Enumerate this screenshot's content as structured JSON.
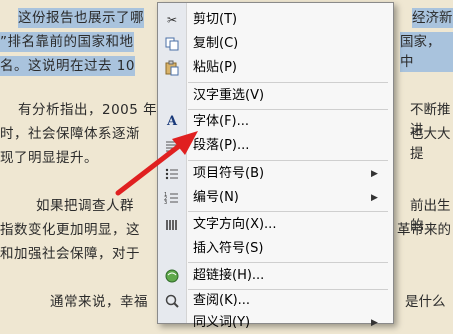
{
  "document": {
    "lines": [
      "这份报告也展示了哪",
      "”排名靠前的国家和地",
      "名。这说明在过去 10",
      "有分析指出，2005 年",
      "时，社会保障体系逐渐",
      "现了明显提升。",
      "如果把调查人群",
      "指数变化更加明显，这",
      "和加强社会保障，对于",
      "通常来说，幸福"
    ],
    "right_fragments": {
      "r1": "经济新",
      "r2": "国家，中",
      "r4": "不断推进",
      "r5": "也大大提",
      "r7": "前出生的",
      "r8": "革带来的",
      "r10": "是什么"
    }
  },
  "context_menu": {
    "cut": "剪切(T)",
    "copy": "复制(C)",
    "paste": "粘贴(P)",
    "reconvert": "汉字重选(V)",
    "font": "字体(F)...",
    "paragraph": "段落(P)...",
    "bullets": "项目符号(B)",
    "numbering": "编号(N)",
    "text_direction": "文字方向(X)...",
    "insert_symbol": "插入符号(S)",
    "hyperlink": "超链接(H)...",
    "lookup": "查阅(K)...",
    "synonyms": "同义词(Y)"
  },
  "colors": {
    "selection": "#a9c3dd",
    "arrow": "#e02020",
    "page_background": "#efe7d2"
  }
}
